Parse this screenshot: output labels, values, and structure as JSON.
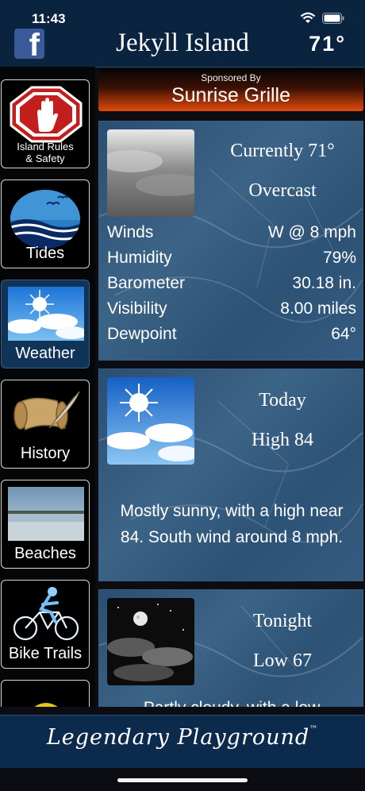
{
  "status": {
    "time": "11:43"
  },
  "header": {
    "title": "Jekyll Island",
    "temperature": "71°"
  },
  "sponsor": {
    "label": "Sponsored By",
    "name": "Sunrise Grille"
  },
  "sidebar": {
    "items": [
      {
        "label": "Island Rules & Safety",
        "icon": "stop-hand-icon"
      },
      {
        "label": "Tides",
        "icon": "waves-icon"
      },
      {
        "label": "Weather",
        "icon": "sunny-clouds-icon"
      },
      {
        "label": "History",
        "icon": "scroll-quill-icon"
      },
      {
        "label": "Beaches",
        "icon": "beach-photo-icon"
      },
      {
        "label": "Bike Trails",
        "icon": "cyclist-icon"
      }
    ]
  },
  "current": {
    "title": "Currently 71°",
    "condition": "Overcast",
    "details": [
      {
        "label": "Winds",
        "value": "W @ 8 mph"
      },
      {
        "label": "Humidity",
        "value": "79%"
      },
      {
        "label": "Barometer",
        "value": "30.18 in."
      },
      {
        "label": "Visibility",
        "value": "8.00 miles"
      },
      {
        "label": "Dewpoint",
        "value": "64°"
      }
    ]
  },
  "forecast": [
    {
      "period": "Today",
      "hilo": "High 84",
      "text": "Mostly sunny, with a high near 84. South wind around 8 mph."
    },
    {
      "period": "Tonight",
      "hilo": "Low 67",
      "text": "Partly cloudy, with a low"
    }
  ],
  "footer": {
    "tagline": "Legendary Playground",
    "mark": "™"
  },
  "colors": {
    "header": "#0a2440",
    "panel": "#2f5579",
    "sponsor_accent": "#e24a0b",
    "active_nav": "#0f3457"
  }
}
